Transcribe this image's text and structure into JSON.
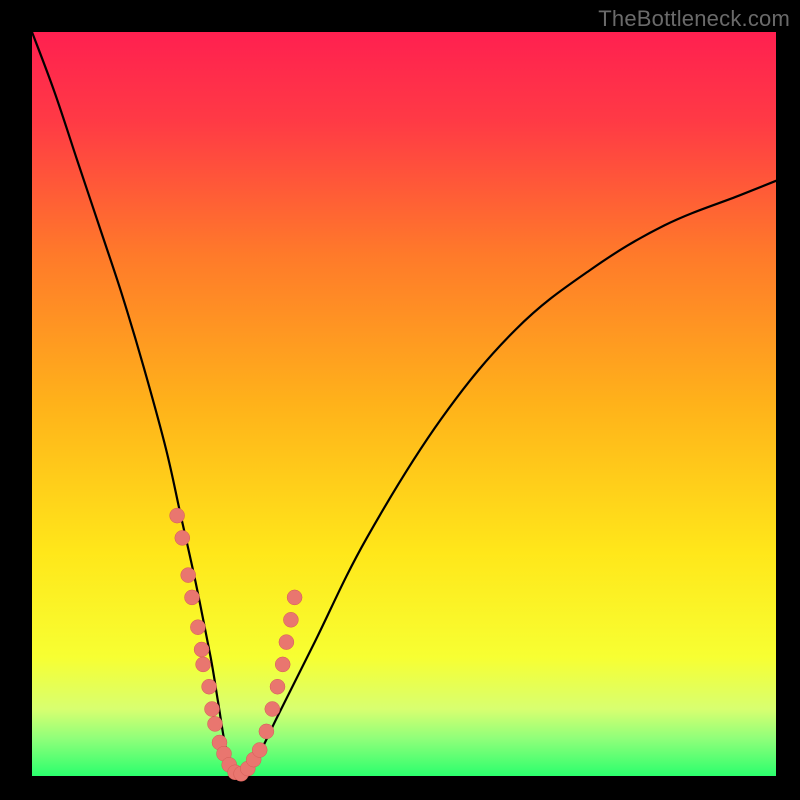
{
  "watermark": {
    "text": "TheBottleneck.com"
  },
  "gradient": {
    "stops": [
      {
        "pct": 0,
        "color": "#ff2050"
      },
      {
        "pct": 12,
        "color": "#ff3a45"
      },
      {
        "pct": 30,
        "color": "#ff7a2a"
      },
      {
        "pct": 50,
        "color": "#ffb21a"
      },
      {
        "pct": 70,
        "color": "#ffe71a"
      },
      {
        "pct": 84,
        "color": "#f7ff32"
      },
      {
        "pct": 91,
        "color": "#d8ff70"
      },
      {
        "pct": 95,
        "color": "#8fff7a"
      },
      {
        "pct": 100,
        "color": "#2bff6d"
      }
    ]
  },
  "chart_data": {
    "type": "line",
    "title": "",
    "xlabel": "",
    "ylabel": "",
    "xlim": [
      0,
      100
    ],
    "ylim": [
      0,
      100
    ],
    "grid": false,
    "legend": false,
    "series": [
      {
        "name": "bottleneck-curve",
        "x": [
          0,
          3,
          6,
          9,
          12,
          15,
          18,
          20,
          22,
          24,
          25,
          26,
          27,
          28,
          30,
          33,
          38,
          45,
          55,
          65,
          75,
          85,
          95,
          100
        ],
        "values": [
          100,
          92,
          83,
          74,
          65,
          55,
          44,
          35,
          26,
          16,
          10,
          4,
          1,
          0,
          2,
          8,
          18,
          32,
          48,
          60,
          68,
          74,
          78,
          80
        ]
      }
    ],
    "points": [
      {
        "x": 19.5,
        "y": 35
      },
      {
        "x": 20.2,
        "y": 32
      },
      {
        "x": 21.0,
        "y": 27
      },
      {
        "x": 21.5,
        "y": 24
      },
      {
        "x": 22.3,
        "y": 20
      },
      {
        "x": 22.8,
        "y": 17
      },
      {
        "x": 23.0,
        "y": 15
      },
      {
        "x": 23.8,
        "y": 12
      },
      {
        "x": 24.2,
        "y": 9
      },
      {
        "x": 24.6,
        "y": 7
      },
      {
        "x": 25.2,
        "y": 4.5
      },
      {
        "x": 25.8,
        "y": 3
      },
      {
        "x": 26.5,
        "y": 1.5
      },
      {
        "x": 27.3,
        "y": 0.5
      },
      {
        "x": 28.1,
        "y": 0.3
      },
      {
        "x": 29.0,
        "y": 1
      },
      {
        "x": 29.8,
        "y": 2.2
      },
      {
        "x": 30.6,
        "y": 3.5
      },
      {
        "x": 31.5,
        "y": 6
      },
      {
        "x": 32.3,
        "y": 9
      },
      {
        "x": 33.0,
        "y": 12
      },
      {
        "x": 33.7,
        "y": 15
      },
      {
        "x": 34.2,
        "y": 18
      },
      {
        "x": 34.8,
        "y": 21
      },
      {
        "x": 35.3,
        "y": 24
      }
    ]
  }
}
